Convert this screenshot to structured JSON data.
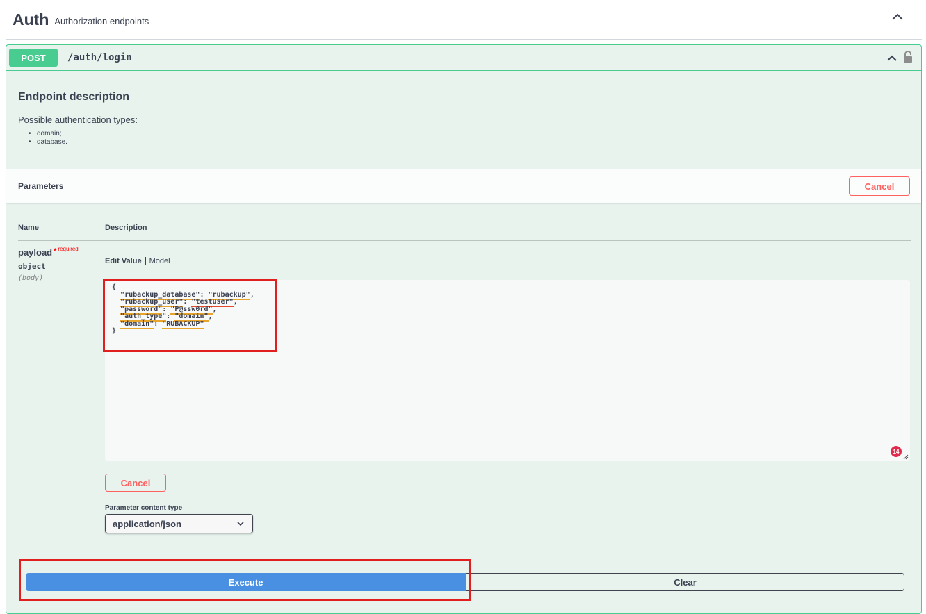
{
  "tag": {
    "name": "Auth",
    "description": "Authorization endpoints"
  },
  "operation": {
    "method": "POST",
    "path": "/auth/login"
  },
  "description": {
    "title": "Endpoint description",
    "text": "Possible authentication types:",
    "items": [
      "domain;",
      "database."
    ]
  },
  "parameters": {
    "title": "Parameters",
    "cancel_label": "Cancel",
    "col_name": "Name",
    "col_description": "Description",
    "param": {
      "name": "payload",
      "star": "*",
      "required": "required",
      "type": "object",
      "in": "(body)"
    },
    "tabs": {
      "edit_value": "Edit Value",
      "model": "Model"
    },
    "body_lines": {
      "l1": "{",
      "l2_key": "\"rubackup_database\"",
      "l2_val": "\"rubackup\"",
      "l3_key": "\"rubackup_user\"",
      "l3_val": "\"testuser\"",
      "l4_key": "\"password\"",
      "l4_val": "\"P@ssw0rd\"",
      "l5_key": "\"auth_type\"",
      "l5_val": "\"domain\"",
      "l6_key": "\"domain\"",
      "l6_val": "\"RUBACKUP\"",
      "l7": "}"
    },
    "issue_count": "14",
    "body_cancel_label": "Cancel",
    "content_type_label": "Parameter content type",
    "content_type_value": "application/json"
  },
  "actions": {
    "execute": "Execute",
    "clear": "Clear"
  },
  "colors": {
    "post": "#49cc90",
    "execute": "#4990e2",
    "cancel": "#ff6060",
    "highlight": "#e21f1f"
  }
}
